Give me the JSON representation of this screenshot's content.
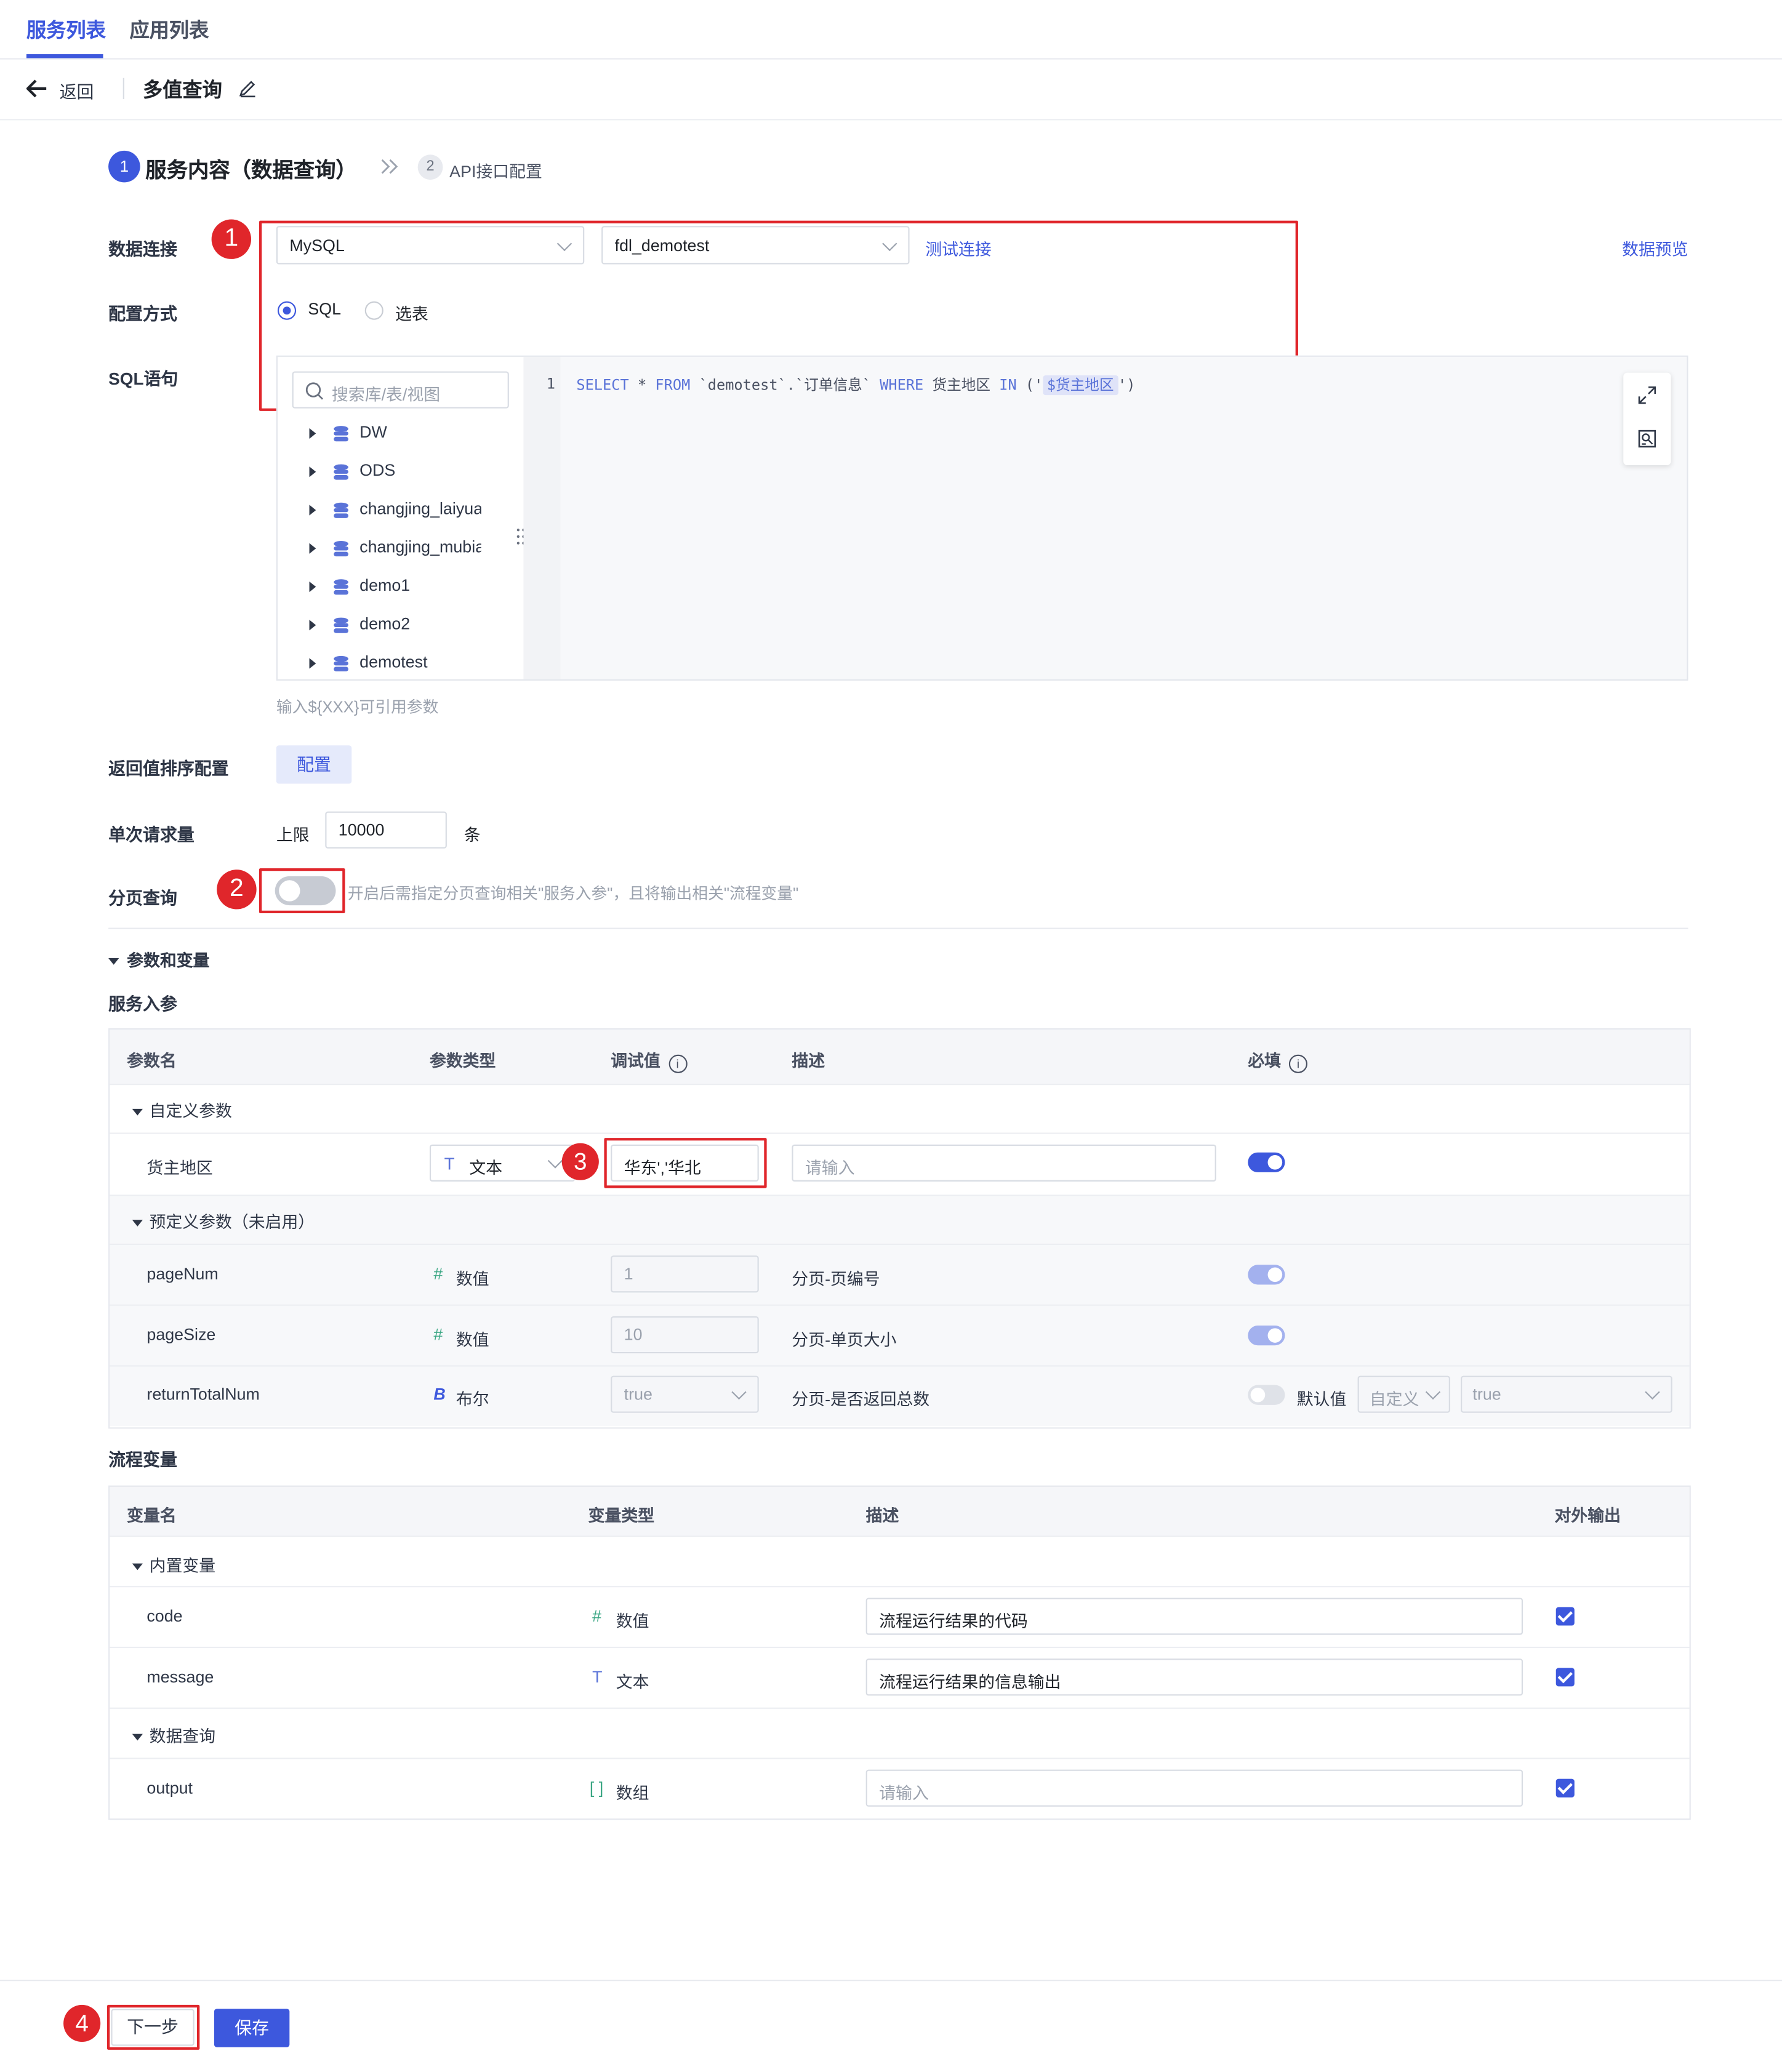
{
  "top_tabs": [
    "服务列表",
    "应用列表"
  ],
  "subbar": {
    "back_label": "返回",
    "title": "多值查询"
  },
  "steps": [
    {
      "num": "1",
      "label": "服务内容（数据查询）"
    },
    {
      "num": "2",
      "label": "API接口配置"
    }
  ],
  "form": {
    "data_connection_label": "数据连接",
    "db_type": "MySQL",
    "db_name": "fdl_demotest",
    "test_connection": "测试连接",
    "data_preview": "数据预览",
    "config_mode_label": "配置方式",
    "config_mode_options": [
      "SQL",
      "选表"
    ],
    "sql_label": "SQL语句",
    "search_placeholder": "搜索库/表/视图",
    "tree_items": [
      "DW",
      "ODS",
      "changjing_laiyuan",
      "changjing_mubiao",
      "demo1",
      "demo2",
      "demotest"
    ],
    "sql_line_no": "1",
    "sql_tokens": {
      "select": "SELECT",
      "star": " * ",
      "from": "FROM",
      "table": " `demotest`.`订单信息` ",
      "where": "WHERE",
      "col": " 货主地区 ",
      "in": "IN",
      "open": " ('",
      "param": "$货主地区",
      "close": "')"
    },
    "sql_hint": "输入${XXX}可引用参数",
    "sort_config_label": "返回值排序配置",
    "sort_config_button": "配置",
    "request_limit_label": "单次请求量",
    "limit_prefix": "上限",
    "limit_value": "10000",
    "limit_suffix": "条",
    "paging_label": "分页查询",
    "paging_hint": "开启后需指定分页查询相关\"服务入参\"，且将输出相关\"流程变量\""
  },
  "annotations": [
    "1",
    "2",
    "3",
    "4"
  ],
  "params_section": {
    "title": "参数和变量",
    "service_params_title": "服务入参",
    "headers": [
      "参数名",
      "参数类型",
      "调试值",
      "描述",
      "必填"
    ],
    "custom_group": "自定义参数",
    "custom_rows": [
      {
        "name": "货主地区",
        "type": "文本",
        "debug_value": "华东','华北",
        "desc_placeholder": "请输入",
        "required": true
      }
    ],
    "predefined_group": "预定义参数（未启用）",
    "predefined_rows": [
      {
        "name": "pageNum",
        "type": "数值",
        "debug_value": "1",
        "desc": "分页-页编号"
      },
      {
        "name": "pageSize",
        "type": "数值",
        "debug_value": "10",
        "desc": "分页-单页大小"
      },
      {
        "name": "returnTotalNum",
        "type": "布尔",
        "debug_value": "true",
        "desc": "分页-是否返回总数",
        "default_label": "默认值",
        "default_mode": "自定义",
        "default_value": "true"
      }
    ]
  },
  "flow_vars": {
    "title": "流程变量",
    "headers": [
      "变量名",
      "变量类型",
      "描述",
      "对外输出"
    ],
    "builtin_group": "内置变量",
    "builtin_rows": [
      {
        "name": "code",
        "type": "数值",
        "desc": "流程运行结果的代码"
      },
      {
        "name": "message",
        "type": "文本",
        "desc": "流程运行结果的信息输出"
      }
    ],
    "query_group": "数据查询",
    "query_rows": [
      {
        "name": "output",
        "type": "数组",
        "desc_placeholder": "请输入"
      }
    ]
  },
  "footer": {
    "next": "下一步",
    "save": "保存"
  },
  "colors": {
    "accent": "#3d58dd",
    "annotation": "#e0262b"
  }
}
